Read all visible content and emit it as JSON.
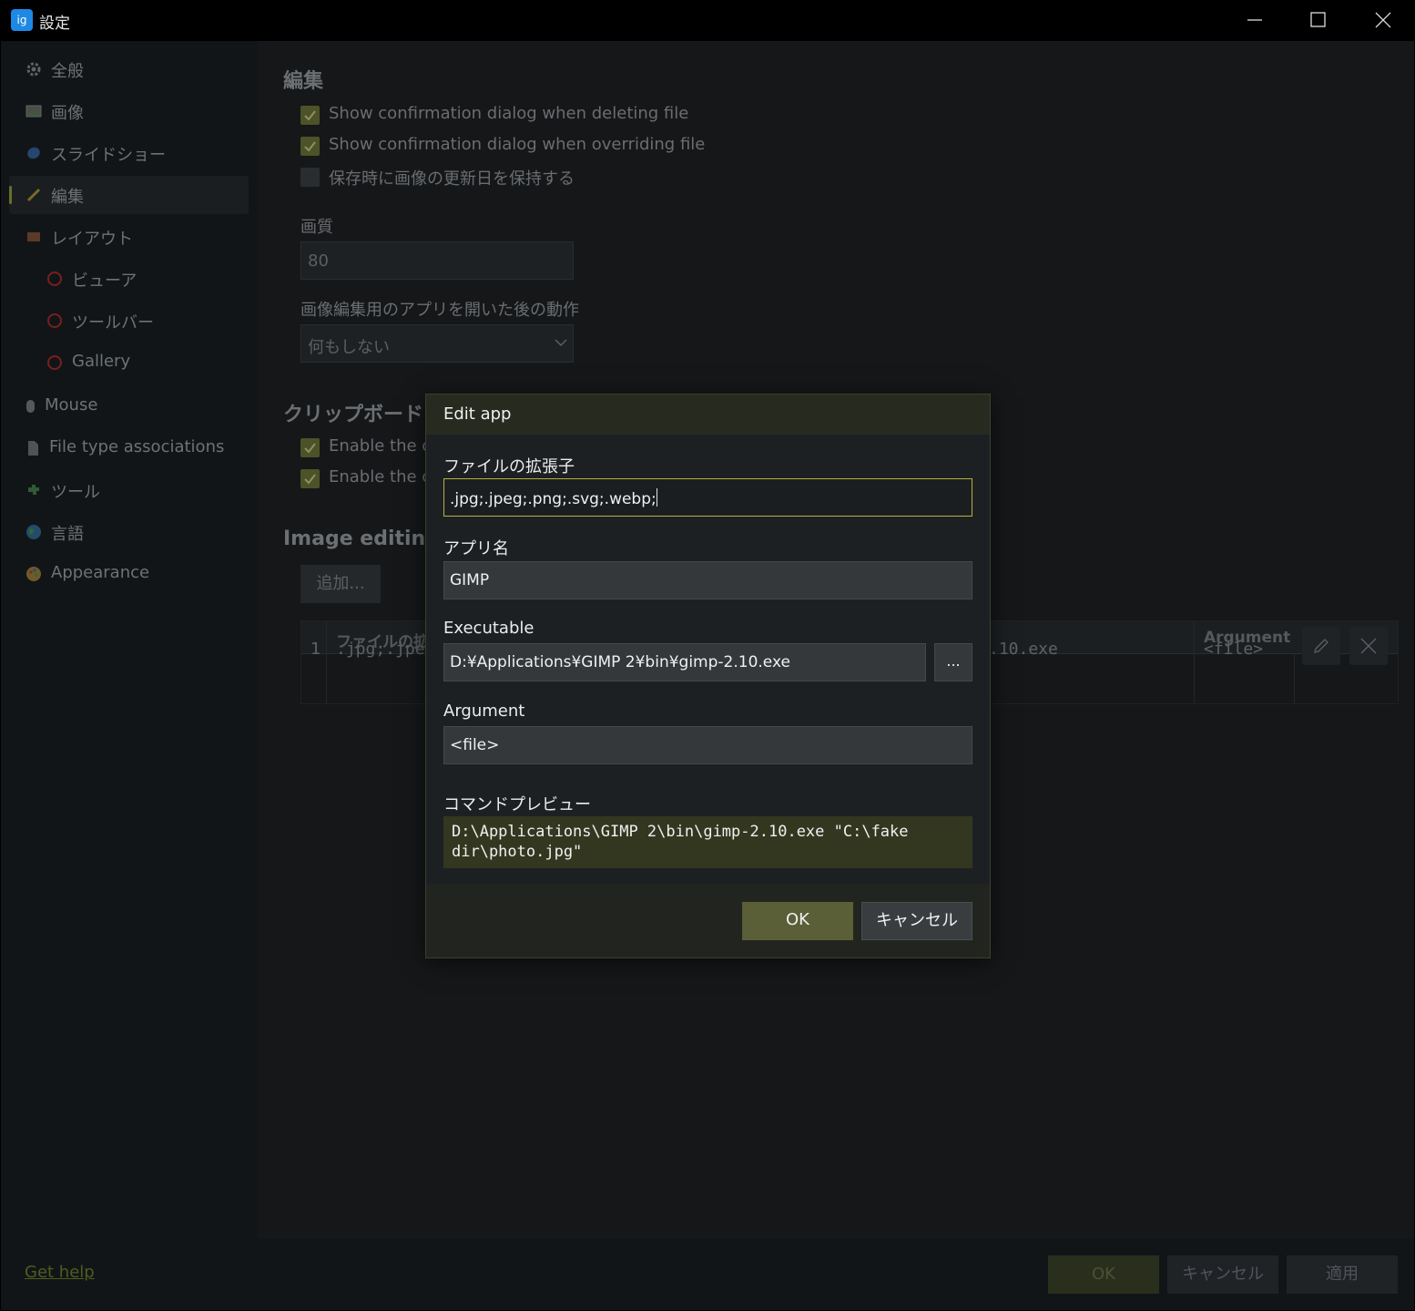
{
  "window": {
    "title": "設定",
    "app_icon_text": "ig"
  },
  "sidebar": {
    "items": [
      {
        "label": "全般",
        "icon": "gear-icon"
      },
      {
        "label": "画像",
        "icon": "image-icon"
      },
      {
        "label": "スライドショー",
        "icon": "slideshow-icon"
      },
      {
        "label": "編集",
        "icon": "pencil-icon",
        "active": true
      },
      {
        "label": "レイアウト",
        "icon": "layout-icon"
      },
      {
        "label": "ビューア",
        "icon": "circle-icon"
      },
      {
        "label": "ツールバー",
        "icon": "circle-icon"
      },
      {
        "label": "Gallery",
        "icon": "circle-icon"
      },
      {
        "label": "Mouse",
        "icon": "mouse-icon"
      },
      {
        "label": "File type associations",
        "icon": "document-icon"
      },
      {
        "label": "ツール",
        "icon": "puzzle-icon"
      },
      {
        "label": "言語",
        "icon": "globe-icon"
      },
      {
        "label": "Appearance",
        "icon": "palette-icon"
      }
    ],
    "help_link": "Get help"
  },
  "edit_section": {
    "title": "編集",
    "checkboxes": [
      {
        "label": "Show confirmation dialog when deleting file",
        "checked": true
      },
      {
        "label": "Show confirmation dialog when overriding file",
        "checked": true
      },
      {
        "label": "保存時に画像の更新日を保持する",
        "checked": false
      }
    ],
    "quality_label": "画質",
    "quality_value": "80",
    "after_open_label": "画像編集用のアプリを開いた後の動作",
    "after_open_value": "何もしない"
  },
  "clipboard_section": {
    "title": "クリップボード",
    "checkboxes": [
      {
        "label": "Enable the co",
        "checked": true
      },
      {
        "label": "Enable the cu",
        "checked": true
      }
    ]
  },
  "apps_section": {
    "title": "Image editing a",
    "add_button": "追加...",
    "table": {
      "headers": [
        "ファイルの拡張",
        "Argument"
      ],
      "rows": [
        {
          "index": "1",
          "extensions": ".jpg;.jpeg",
          "executable_tail": ".10.exe",
          "argument": "<file>"
        }
      ]
    }
  },
  "footer": {
    "ok": "OK",
    "cancel": "キャンセル",
    "apply": "適用"
  },
  "dialog": {
    "title": "Edit app",
    "extensions_label": "ファイルの拡張子",
    "extensions_value": ".jpg;.jpeg;.png;.svg;.webp;",
    "app_name_label": "アプリ名",
    "app_name_value": "GIMP",
    "executable_label": "Executable",
    "executable_value": "D:¥Applications¥GIMP 2¥bin¥gimp-2.10.exe",
    "browse_button": "...",
    "argument_label": "Argument",
    "argument_value": "<file>",
    "preview_label": "コマンドプレビュー",
    "preview_line1": "D:\\Applications\\GIMP 2\\bin\\gimp-2.10.exe \"C:\\fake",
    "preview_line2": "dir\\photo.jpg\"",
    "ok_button": "OK",
    "cancel_button": "キャンセル"
  },
  "colors": {
    "accent": "#5a5f37",
    "focus_border": "#b4b23c",
    "background": "#121518"
  }
}
